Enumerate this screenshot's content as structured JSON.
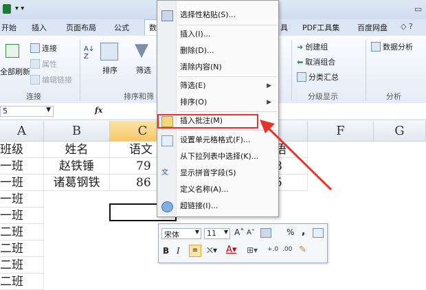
{
  "titlebar": {
    "qat": "▾ ▾"
  },
  "tabs": [
    "开始",
    "插入",
    "页面布局",
    "公式",
    "数",
    "具",
    "PDF工具集",
    "百度网盘"
  ],
  "ribbon": {
    "refresh_all": "全部刷新",
    "connections": "连接",
    "properties": "属性",
    "edit_links": "编辑链接",
    "sort": "排序",
    "filter": "筛选",
    "create_group": "创建组",
    "ungroup": "取消组合",
    "subtotal": "分类汇总",
    "data_analysis": "数据分析",
    "groups": {
      "connections": "连接",
      "sort_filter": "排序和筛",
      "outline": "分级显示",
      "analysis": "分析"
    }
  },
  "formula": {
    "name_box": "5",
    "fx": "fx"
  },
  "columns": [
    "A",
    "B",
    "C",
    "D",
    "E",
    "F",
    "G"
  ],
  "cells": {
    "a": [
      "班级",
      "一班",
      "一班",
      "一班",
      "一班",
      "二班",
      "二班",
      "二班",
      "二班"
    ],
    "b": [
      "姓名",
      "赵铁锤",
      "诸葛钢铁"
    ],
    "c": [
      "语文",
      "79",
      "86"
    ],
    "e": [
      "语",
      "8",
      "5"
    ]
  },
  "context_menu": {
    "items": [
      {
        "label": "选择性粘贴(S)...",
        "arrow": false
      },
      {
        "label": "插入(I)...",
        "arrow": false
      },
      {
        "label": "删除(D)...",
        "arrow": false
      },
      {
        "label": "清除内容(N)",
        "arrow": false
      },
      {
        "label": "筛选(E)",
        "arrow": true
      },
      {
        "label": "排序(O)",
        "arrow": true
      },
      {
        "label": "插入批注(M)",
        "arrow": false
      },
      {
        "label": "设置单元格格式(F)...",
        "arrow": false
      },
      {
        "label": "从下拉列表中选择(K)...",
        "arrow": false
      },
      {
        "label": "显示拼音字段(S)",
        "arrow": false
      },
      {
        "label": "定义名称(A)...",
        "arrow": false
      },
      {
        "label": "超链接(I)...",
        "arrow": false
      }
    ]
  },
  "minibar": {
    "font": "宋体",
    "size": "11",
    "bold": "B",
    "italic": "I",
    "percent": "%",
    "comma": ","
  },
  "colors": {
    "highlight": "#e8332a",
    "selected_col": "#f6c86a",
    "ribbon_bg": "#e4ecf7"
  }
}
